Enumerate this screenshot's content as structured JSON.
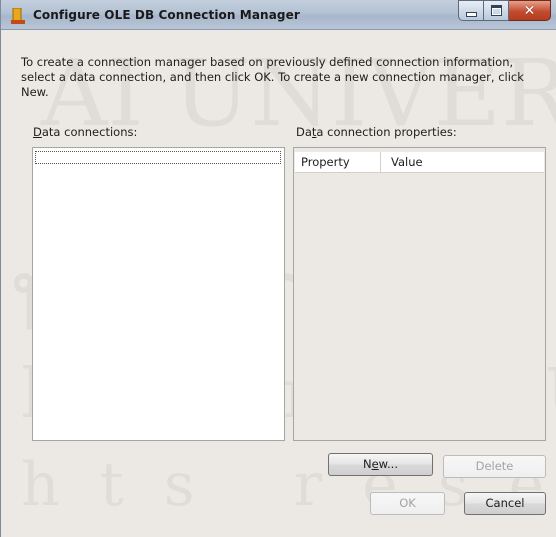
{
  "window": {
    "title": "Configure OLE DB Connection Manager",
    "controls": {
      "minimize_icon": "minimize-icon",
      "maximize_icon": "maximize-icon",
      "close_icon": "close-icon"
    },
    "accent_close_color": "#c24c2f"
  },
  "intro_text": "To create a connection manager based on previously defined connection information, select a data connection, and then click OK. To create a new connection manager, click New.",
  "data_connections": {
    "label_prefix": "",
    "label_accel": "D",
    "label_rest": "ata connections:",
    "items": []
  },
  "properties": {
    "label_prefix": "Da",
    "label_accel": "t",
    "label_rest": "a connection properties:",
    "columns": [
      "Property",
      "Value"
    ]
  },
  "buttons": {
    "new_prefix": "N",
    "new_accel": "e",
    "new_rest": "w...",
    "delete": "Delete",
    "ok": "OK",
    "cancel": "Cancel"
  }
}
